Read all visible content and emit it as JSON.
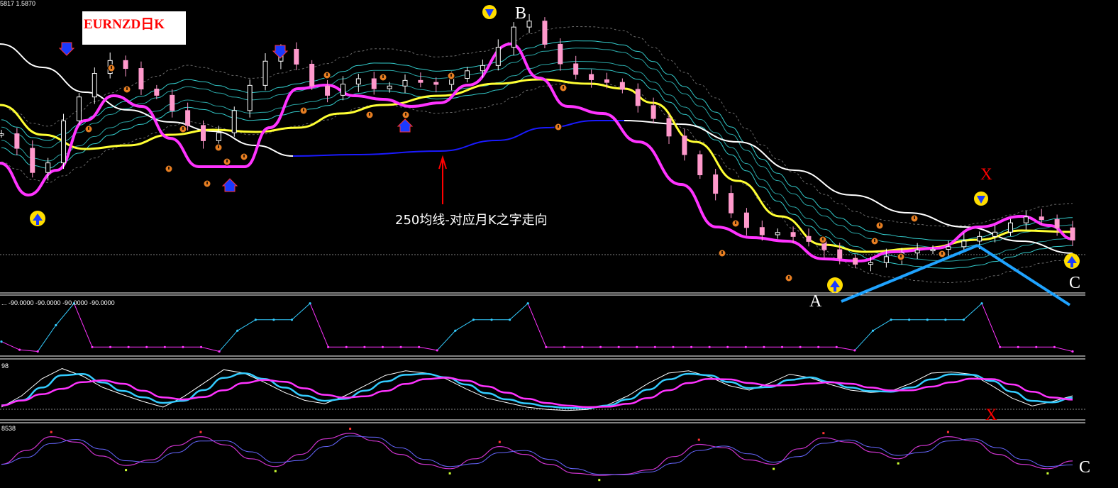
{
  "header": {
    "top_left_label": "5817 1.5870",
    "title": "EURNZD日K"
  },
  "annotations": {
    "ma250_note": "250均线-对应月K之字走向",
    "point_a": "A",
    "point_b": "B",
    "point_c_main": "C",
    "point_x_main": "X",
    "point_x_osc": "X",
    "point_c_osc": "C"
  },
  "colors": {
    "background": "#000000",
    "candle_up": "#ffffff",
    "candle_down": "#ff99cc",
    "ma_magenta": "#ff33ff",
    "ma_yellow": "#ffff33",
    "ma_white": "#ffffff",
    "ma_blue": "#1a1aff",
    "band_cyan": "#33cccc",
    "trend_line": "#1fa3ff",
    "marker_orange": "#e67e22",
    "marker_yellow": "#ffdd00",
    "annotation_red": "#ff0000"
  },
  "icons": [
    "down-arrow-marker-icon",
    "up-arrow-marker-icon",
    "exclamation-dot-icon"
  ],
  "panels": {
    "indicator1": {
      "label": "... -90.0000 -90.0000 -90.0000 -90.0000"
    },
    "indicator2": {
      "label": "98"
    },
    "indicator3": {
      "label": "8538"
    }
  },
  "chart_data": [
    {
      "type": "candlestick",
      "title": "EURNZD日K",
      "series": [
        {
          "name": "close",
          "values": [
            1.6342,
            1.6298,
            1.6225,
            1.6254,
            1.6381,
            1.6453,
            1.6524,
            1.6563,
            1.6539,
            1.6477,
            1.6458,
            1.6412,
            1.6367,
            1.6321,
            1.6345,
            1.6412,
            1.6488,
            1.6561,
            1.6597,
            1.6552,
            1.6486,
            1.6458,
            1.6492,
            1.6508,
            1.6478,
            1.6486,
            1.6503,
            1.6497,
            1.6491,
            1.6509,
            1.6532,
            1.6548,
            1.6603,
            1.6664,
            1.6682,
            1.6612,
            1.6553,
            1.6521,
            1.6505,
            1.6497,
            1.6476,
            1.6427,
            1.6388,
            1.6335,
            1.6279,
            1.6218,
            1.6162,
            1.6103,
            1.6059,
            1.6037,
            1.6044,
            1.6032,
            1.6017,
            1.5992,
            1.5966,
            1.5948,
            1.5953,
            1.5971,
            1.5982,
            1.5991,
            1.5993,
            1.6001,
            1.6018,
            1.6032,
            1.6045,
            1.6073,
            1.6091,
            1.6083,
            1.6058,
            1.6021
          ]
        }
      ]
    },
    {
      "type": "line",
      "series": [
        {
          "name": "",
          "values": [
            -80,
            -95,
            -98,
            -50,
            -10,
            -90,
            -90,
            -90,
            -90,
            -90,
            -90,
            -90,
            -98,
            -60,
            -40,
            -40,
            -40,
            -10,
            -90,
            -90,
            -90,
            -90,
            -90,
            -90,
            -96,
            -60,
            -40,
            -40,
            -40,
            -10,
            -90,
            -90,
            -90,
            -90,
            -90,
            -90,
            -90,
            -90,
            -90,
            -90,
            -90,
            -90,
            -90,
            -90,
            -90,
            -90,
            -90,
            -96,
            -60,
            -40,
            -40,
            -40,
            -40,
            -40,
            -10,
            -90,
            -90,
            -90,
            -90,
            -98
          ]
        }
      ]
    },
    {
      "type": "line",
      "series": [
        {
          "name": "",
          "values": [
            20,
            40,
            70,
            88,
            75,
            55,
            42,
            30,
            20,
            38,
            62,
            86,
            80,
            64,
            46,
            32,
            26,
            40,
            58,
            76,
            84,
            80,
            70,
            52,
            36,
            28,
            20,
            16,
            14,
            16,
            24,
            40,
            62,
            80,
            84,
            74,
            58,
            50,
            62,
            78,
            72,
            60,
            50,
            46,
            48,
            62,
            80,
            82,
            78,
            58,
            36,
            22,
            30,
            40
          ]
        }
      ]
    },
    {
      "type": "line",
      "series": [
        {
          "name": "",
          "values": [
            30,
            55,
            80,
            70,
            45,
            28,
            38,
            64,
            80,
            65,
            40,
            26,
            48,
            76,
            86,
            72,
            48,
            30,
            22,
            40,
            62,
            48,
            30,
            14,
            10,
            12,
            20,
            44,
            66,
            60,
            38,
            30,
            58,
            78,
            70,
            52,
            40,
            64,
            80,
            72,
            48,
            30,
            22,
            36
          ]
        }
      ]
    }
  ]
}
